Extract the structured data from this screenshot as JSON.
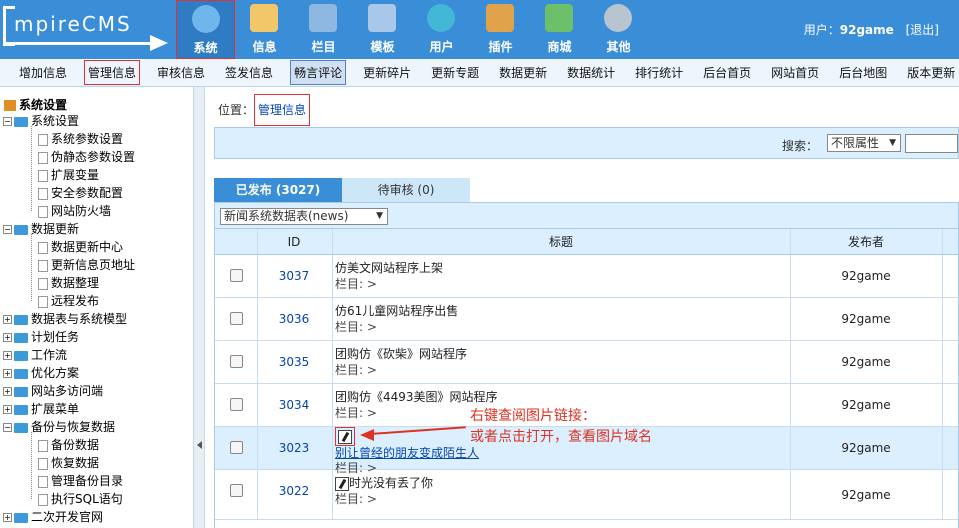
{
  "header": {
    "logo_text": "mpireCMS",
    "nav": [
      {
        "label": "系统",
        "icon": "globe-icon",
        "color": "#6fb6ec",
        "active": true
      },
      {
        "label": "信息",
        "icon": "notepad-icon",
        "color": "#f2c76a"
      },
      {
        "label": "栏目",
        "icon": "folder-icon",
        "color": "#8fb8e0"
      },
      {
        "label": "模板",
        "icon": "window-icon",
        "color": "#a9c7e8"
      },
      {
        "label": "用户",
        "icon": "user-icon",
        "color": "#43b7d6"
      },
      {
        "label": "插件",
        "icon": "tools-icon",
        "color": "#e0a24a"
      },
      {
        "label": "商城",
        "icon": "card-icon",
        "color": "#6cc06a"
      },
      {
        "label": "其他",
        "icon": "gear-icon",
        "color": "#b8c4d0"
      }
    ],
    "user_label": "用户：",
    "username": "92game",
    "logout": "[退出]"
  },
  "subnav": [
    "增加信息",
    "管理信息",
    "审核信息",
    "签发信息",
    "畅言评论",
    "更新碎片",
    "更新专题",
    "数据更新",
    "数据统计",
    "排行统计",
    "后台首页",
    "网站首页",
    "后台地图",
    "版本更新"
  ],
  "tree": {
    "root": "系统设置",
    "groups": [
      {
        "label": "系统设置",
        "children": [
          "系统参数设置",
          "伪静态参数设置",
          "扩展变量",
          "安全参数配置",
          "网站防火墙"
        ]
      },
      {
        "label": "数据更新",
        "children": [
          "数据更新中心",
          "更新信息页地址",
          "数据整理",
          "远程发布"
        ]
      },
      {
        "label": "数据表与系统模型",
        "children": []
      },
      {
        "label": "计划任务",
        "children": []
      },
      {
        "label": "工作流",
        "children": []
      },
      {
        "label": "优化方案",
        "children": []
      },
      {
        "label": "网站多访问端",
        "children": []
      },
      {
        "label": "扩展菜单",
        "children": []
      },
      {
        "label": "备份与恢复数据",
        "children": [
          "备份数据",
          "恢复数据",
          "管理备份目录",
          "执行SQL语句"
        ]
      },
      {
        "label": "二次开发官网",
        "children": []
      }
    ]
  },
  "main": {
    "position_label": "位置：",
    "position_link": "管理信息",
    "search_label": "搜索：",
    "search_select": "不限属性",
    "tabs": [
      "已发布 (3027)",
      "待审核 (0)"
    ],
    "table_select": "新闻系统数据表(news)",
    "columns": [
      "ID",
      "标题",
      "发布者"
    ],
    "rows": [
      {
        "id": "3037",
        "title": "仿美文网站程序上架",
        "column": "栏目: >",
        "publisher": "92game"
      },
      {
        "id": "3036",
        "title": "仿61儿童网站程序出售",
        "column": "栏目: >",
        "publisher": "92game"
      },
      {
        "id": "3035",
        "title": "团购仿《砍柴》网站程序",
        "column": "栏目: >",
        "publisher": "92game"
      },
      {
        "id": "3034",
        "title": "团购仿《4493美图》网站程序",
        "column": "栏目: >",
        "publisher": "92game"
      },
      {
        "id": "3023",
        "title": "别让曾经的朋友变成陌生人",
        "column": "栏目: >",
        "publisher": "92game"
      },
      {
        "id": "3022",
        "title": "时光没有丢了你",
        "column": "栏目: >",
        "publisher": "92game"
      }
    ]
  },
  "annotation": {
    "line1": "右键查阅图片链接：",
    "line2": "或者点击打开，查看图片域名",
    "color": "#d32222"
  }
}
